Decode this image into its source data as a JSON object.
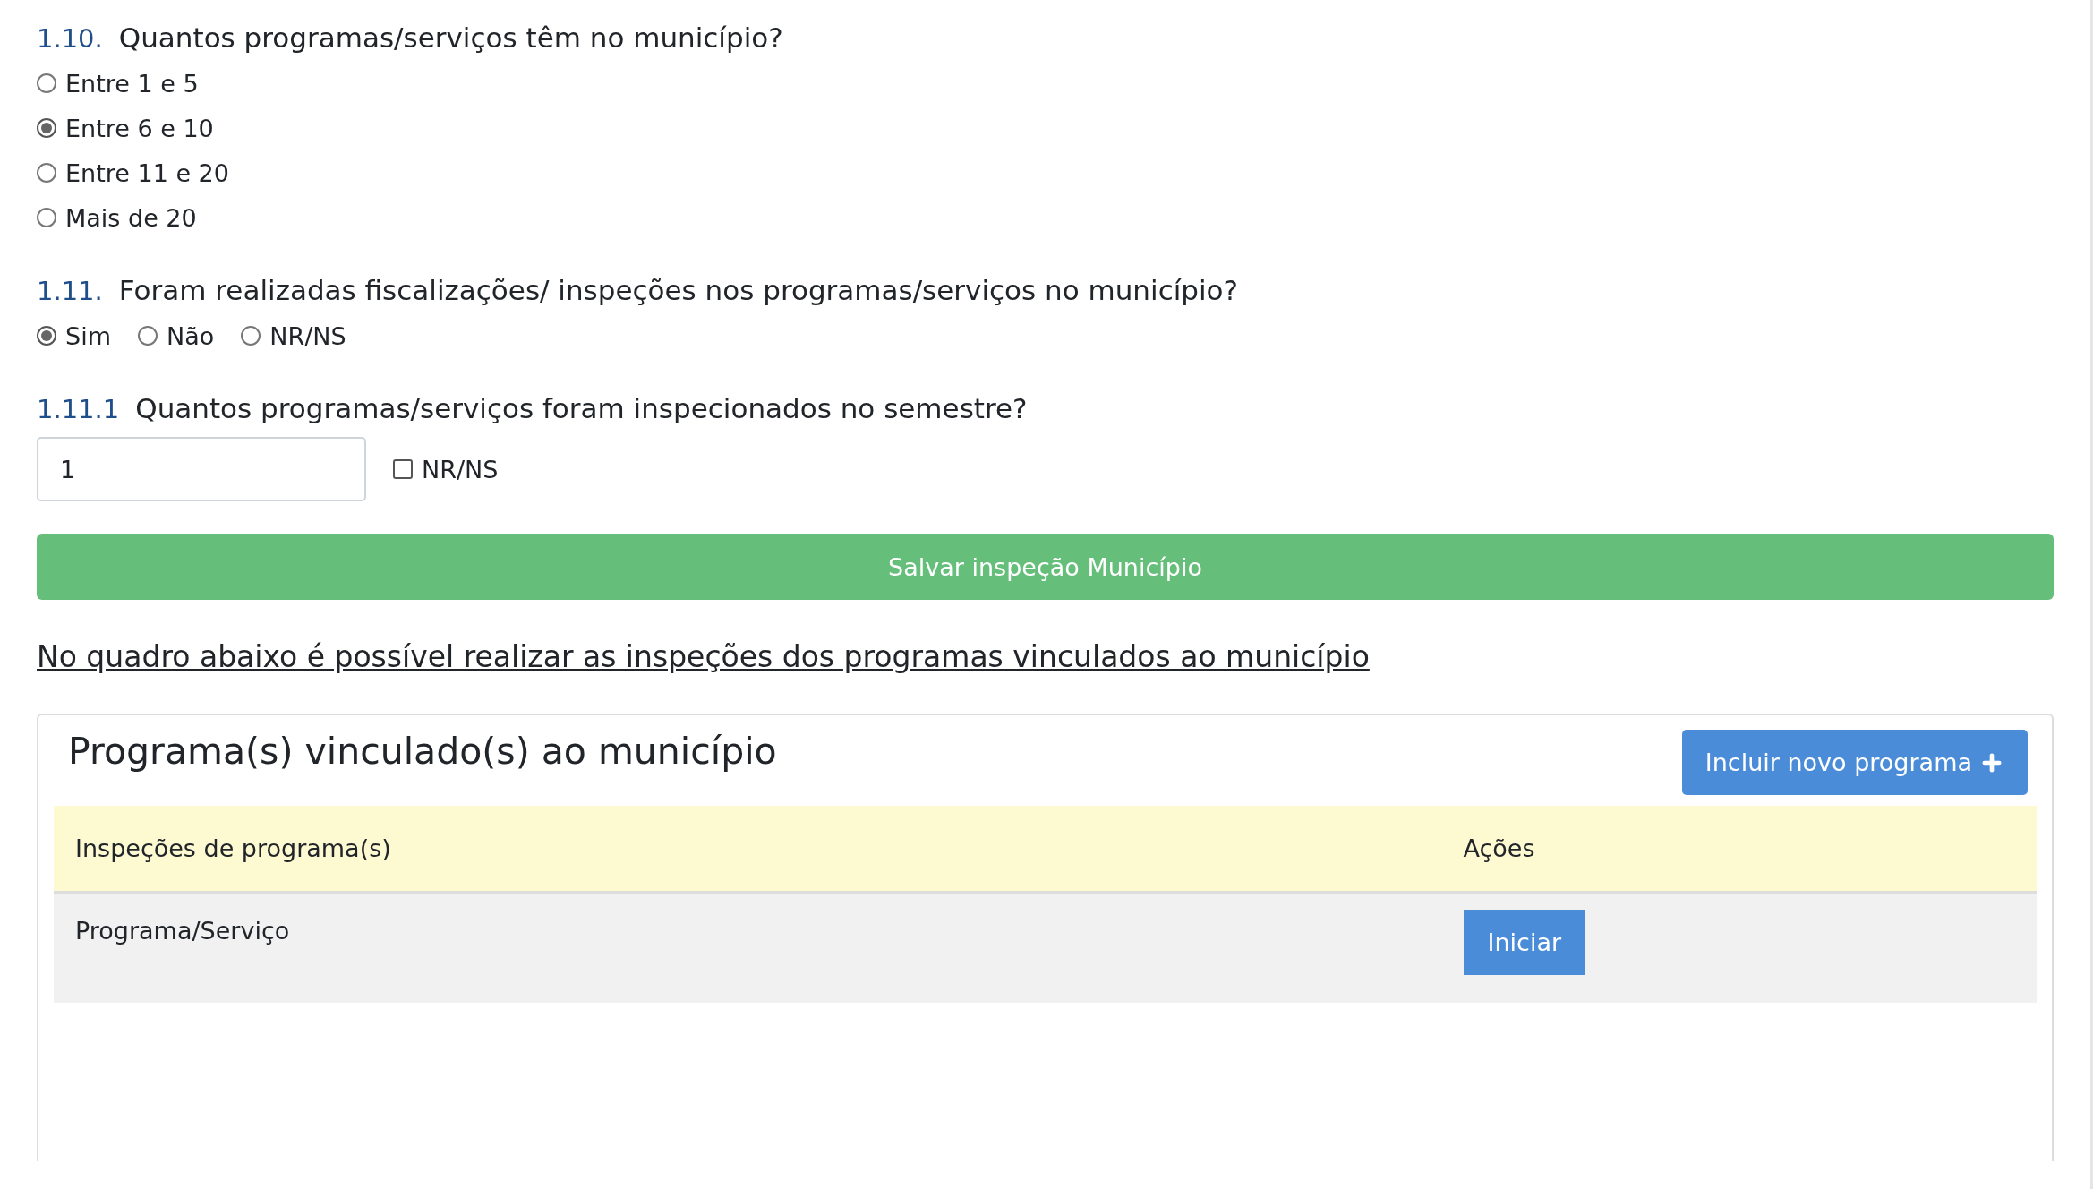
{
  "questions": [
    {
      "number": "1.10.",
      "text": "Quantos programas/serviços têm no município?",
      "kind": "radio-list",
      "options": [
        {
          "label": "Entre 1 e 5",
          "selected": false
        },
        {
          "label": "Entre 6 e 10",
          "selected": true
        },
        {
          "label": "Entre 11 e 20",
          "selected": false
        },
        {
          "label": "Mais de 20",
          "selected": false
        }
      ]
    },
    {
      "number": "1.11.",
      "text": "Foram realizadas fiscalizações/ inspeções nos programas/serviços no município?",
      "kind": "radio-inline",
      "options": [
        {
          "label": "Sim",
          "selected": true
        },
        {
          "label": "Não",
          "selected": false
        },
        {
          "label": "NR/NS",
          "selected": false
        }
      ]
    },
    {
      "number": "1.11.1",
      "text": "Quantos programas/serviços foram inspecionados no semestre?",
      "kind": "number-input",
      "value": "1",
      "checkbox": {
        "label": "NR/NS",
        "checked": false
      }
    }
  ],
  "save_button": "Salvar inspeção Município",
  "note_link": "No quadro abaixo é possível realizar as inspeções dos programas vinculados ao município",
  "panel": {
    "title": "Programa(s) vinculado(s) ao município",
    "add_button": "Incluir novo programa",
    "table": {
      "columns": [
        "Inspeções de programa(s)",
        "Ações"
      ],
      "rows": [
        {
          "name": "Programa/Serviço",
          "action": "Iniciar"
        }
      ]
    }
  }
}
